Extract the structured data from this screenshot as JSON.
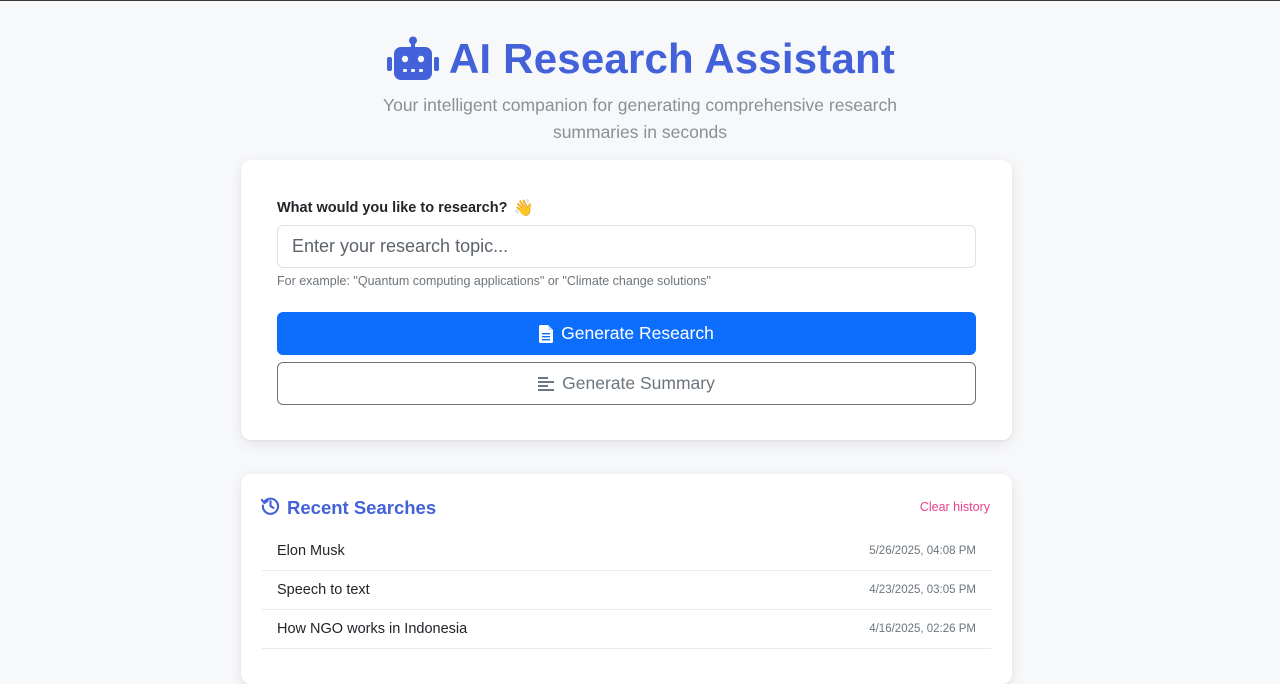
{
  "header": {
    "title": "AI Research Assistant",
    "subtitle": "Your intelligent companion for generating comprehensive research summaries in seconds",
    "icon": "robot-icon",
    "accent_color": "#4361d8"
  },
  "form": {
    "label": "What would you like to research?",
    "label_emoji": "👋",
    "input_placeholder": "Enter your research topic...",
    "input_value": "",
    "hint": "For example: \"Quantum computing applications\" or \"Climate change solutions\"",
    "primary_button": {
      "label": "Generate Research",
      "icon": "file-text-icon",
      "color": "#0d6efd"
    },
    "secondary_button": {
      "label": "Generate Summary",
      "icon": "align-left-icon"
    }
  },
  "history": {
    "title": "Recent Searches",
    "icon": "history-icon",
    "clear_label": "Clear history",
    "clear_color": "#e83e8c",
    "items": [
      {
        "topic": "Elon Musk",
        "time": "5/26/2025, 04:08 PM"
      },
      {
        "topic": "Speech to text",
        "time": "4/23/2025, 03:05 PM"
      },
      {
        "topic": "How NGO works in Indonesia",
        "time": "4/16/2025, 02:26 PM"
      }
    ]
  }
}
